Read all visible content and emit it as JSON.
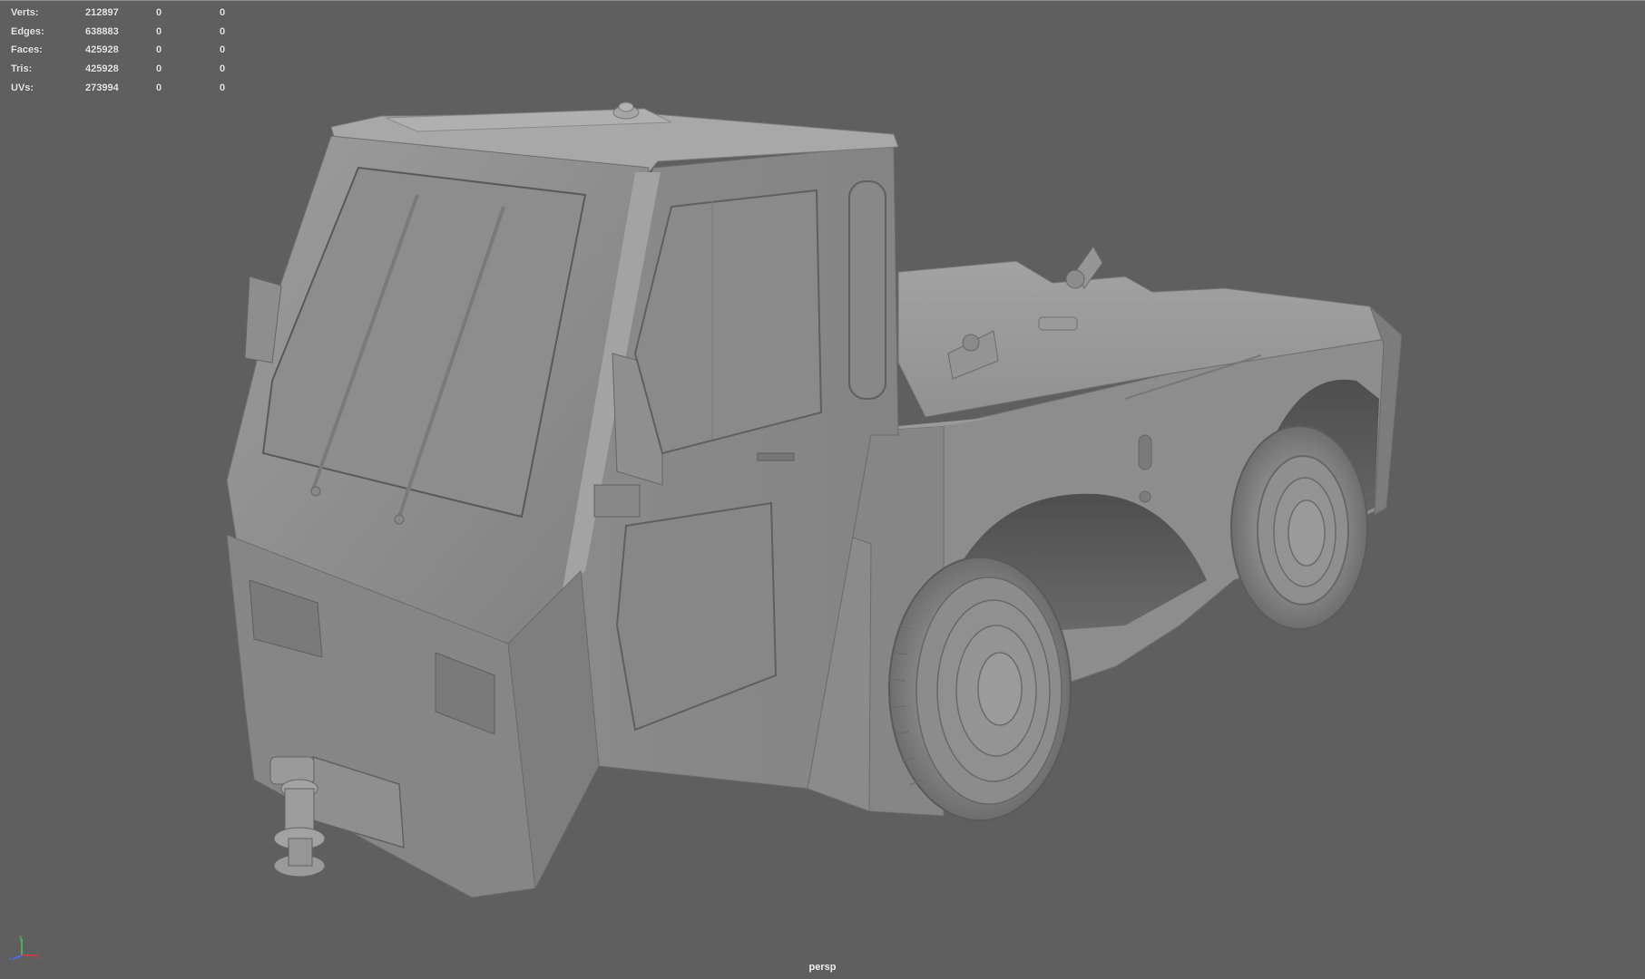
{
  "hud": {
    "rows": [
      {
        "label": "Verts:",
        "total": "212897",
        "selected": "0",
        "component": "0"
      },
      {
        "label": "Edges:",
        "total": "638883",
        "selected": "0",
        "component": "0"
      },
      {
        "label": "Faces:",
        "total": "425928",
        "selected": "0",
        "component": "0"
      },
      {
        "label": "Tris:",
        "total": "425928",
        "selected": "0",
        "component": "0"
      },
      {
        "label": "UVs:",
        "total": "273994",
        "selected": "0",
        "component": "0"
      }
    ]
  },
  "viewport": {
    "camera_label": "persp",
    "background_color": "#5f5f5f",
    "model_color": "#8e8e8e",
    "axis_colors": {
      "x": "#d93b3b",
      "y": "#3fcf5a",
      "z": "#4a6bff"
    },
    "axis_icon": "view-axis-gizmo-icon",
    "model_icon": "tow-tractor-model-icon"
  }
}
